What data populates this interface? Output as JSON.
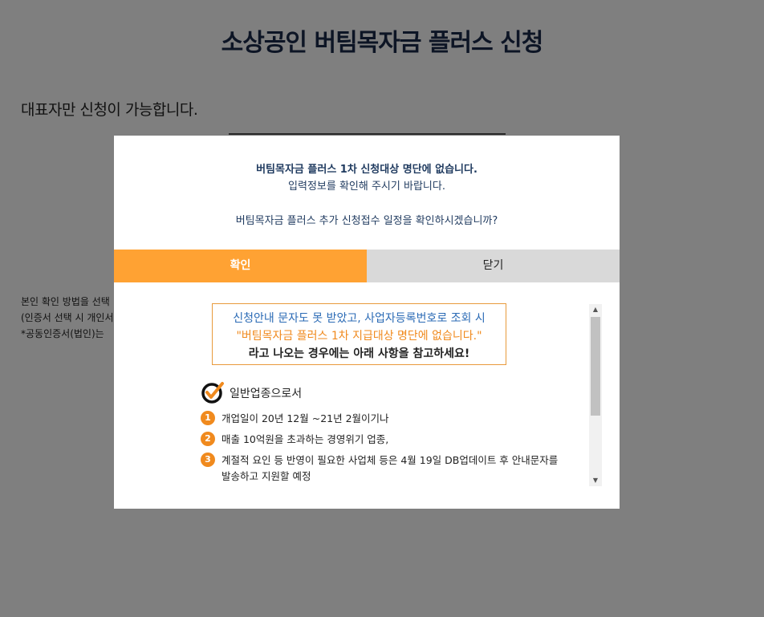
{
  "page": {
    "title": "소상공인 버팀목자금 플러스 신청",
    "subtitle": "대표자만 신청이 가능합니다.",
    "notes": [
      "본인 확인 방법을 선택",
      "(인증서 선택 시 개인서",
      "*공동인증서(법인)는"
    ]
  },
  "modal": {
    "message_line1": "버팀목자금 플러스 1차 신청대상 명단에 없습니다.",
    "message_line2": "입력정보를 확인해 주시기 바랍니다.",
    "message_line3": "버팀목자금 플러스 추가 신청접수 일정을 확인하시겠습니까?",
    "confirm_label": "확인",
    "close_label": "닫기",
    "notice": {
      "box_line1": "신청안내 문자도 못 받았고, 사업자등록번호로 조회 시",
      "box_line2": "\"버팀목자금 플러스 1차 지급대상 명단에 없습니다.\"",
      "box_line3": "라고 나오는 경우에는 아래 사항을 참고하세요!",
      "section_title": "일반업종으로서",
      "items": [
        {
          "num": "1",
          "text": "개업일이 20년 12월 ~21년 2월이기나"
        },
        {
          "num": "2",
          "text": "매출 10억원을 초과하는 경영위기 업종,"
        },
        {
          "num": "3",
          "text": "계절적 요인 등 반영이 필요한 사업체 등은 4월 19일 DB업데이트 후 안내문자를 발송하고 지원할 예정"
        }
      ]
    }
  },
  "colors": {
    "accent_orange": "#ffa233",
    "number_orange": "#f08a1e",
    "title_navy": "#1a2a4a",
    "close_gray": "#d9d9d9"
  }
}
